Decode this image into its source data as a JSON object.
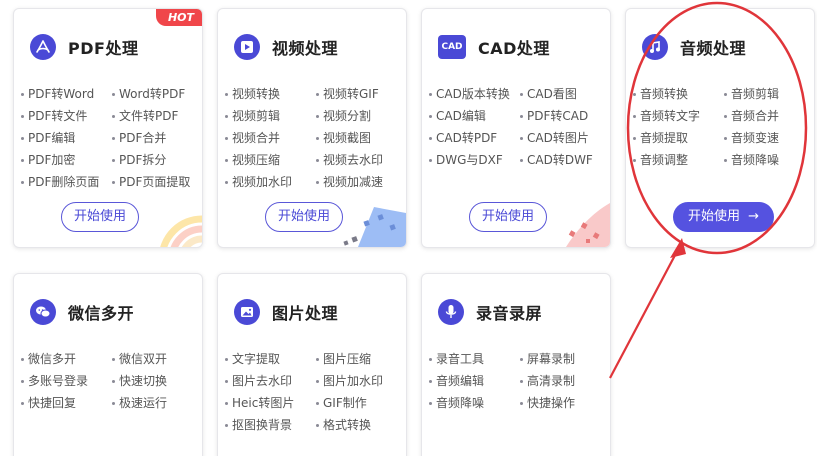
{
  "cards": [
    {
      "title": "PDF处理",
      "icon": "pdf-icon",
      "badge": "HOT",
      "features": [
        "PDF转Word",
        "Word转PDF",
        "PDF转文件",
        "文件转PDF",
        "PDF编辑",
        "PDF合并",
        "PDF加密",
        "PDF拆分",
        "PDF删除页面",
        "PDF页面提取"
      ],
      "button": "开始使用"
    },
    {
      "title": "视频处理",
      "icon": "video-play-icon",
      "features": [
        "视频转换",
        "视频转GIF",
        "视频剪辑",
        "视频分割",
        "视频合并",
        "视频截图",
        "视频压缩",
        "视频去水印",
        "视频加水印",
        "视频加减速"
      ],
      "button": "开始使用"
    },
    {
      "title": "CAD处理",
      "icon": "cad-icon",
      "icon_text": "CAD",
      "features": [
        "CAD版本转换",
        "CAD看图",
        "CAD编辑",
        "PDF转CAD",
        "CAD转PDF",
        "CAD转图片",
        "DWG与DXF",
        "CAD转DWF"
      ],
      "button": "开始使用"
    },
    {
      "title": "音频处理",
      "icon": "music-note-icon",
      "features": [
        "音频转换",
        "音频剪辑",
        "音频转文字",
        "音频合并",
        "音频提取",
        "音频变速",
        "音频调整",
        "音频降噪"
      ],
      "button": "开始使用",
      "button_arrow": "→"
    },
    {
      "title": "微信多开",
      "icon": "wechat-icon",
      "features": [
        "微信多开",
        "微信双开",
        "多账号登录",
        "快速切换",
        "快捷回复",
        "极速运行"
      ]
    },
    {
      "title": "图片处理",
      "icon": "image-icon",
      "features": [
        "文字提取",
        "图片压缩",
        "图片去水印",
        "图片加水印",
        "Heic转图片",
        "GIF制作",
        "抠图换背景",
        "格式转换"
      ]
    },
    {
      "title": "录音录屏",
      "icon": "microphone-icon",
      "features": [
        "录音工具",
        "屏幕录制",
        "音频编辑",
        "高清录制",
        "音频降噪",
        "快捷操作"
      ]
    }
  ],
  "colors": {
    "accent": "#4a49d6",
    "hot_badge": "#f0464a",
    "annotation": "#e0353a"
  }
}
